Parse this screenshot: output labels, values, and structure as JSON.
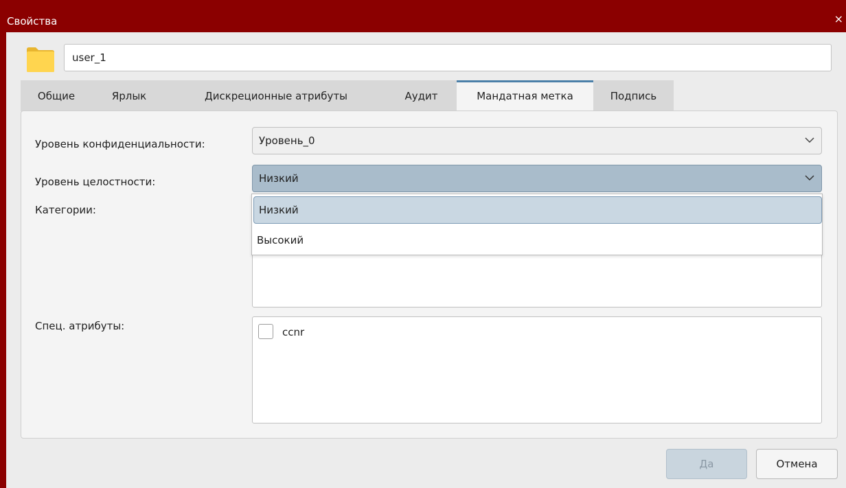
{
  "window": {
    "title": "Свойства",
    "close_symbol": "×"
  },
  "file": {
    "icon": "folder-icon",
    "name": "user_1"
  },
  "tabs": [
    {
      "label": "Общие"
    },
    {
      "label": "Ярлык"
    },
    {
      "label": "Дискреционные атрибуты"
    },
    {
      "label": "Аудит"
    },
    {
      "label": "Мандатная метка",
      "active": true
    },
    {
      "label": "Подпись"
    }
  ],
  "mandatory": {
    "confidentiality_label": "Уровень конфиденциальности:",
    "confidentiality_value": "Уровень_0",
    "integrity_label": "Уровень целостности:",
    "integrity_value": "Низкий",
    "integrity_options": [
      "Низкий",
      "Высокий"
    ],
    "categories_label": "Категории:",
    "special_label": "Спец. атрибуты:",
    "special_items": [
      {
        "label": "ccnr",
        "checked": false
      }
    ]
  },
  "buttons": {
    "ok": "Да",
    "cancel": "Отмена"
  },
  "colors": {
    "titlebar": "#8b0000",
    "active_tab_accent": "#4a7fa8",
    "selected_combo": "#a9bccb",
    "selected_option": "#c9d7e2",
    "folder": "#ffd54f"
  }
}
